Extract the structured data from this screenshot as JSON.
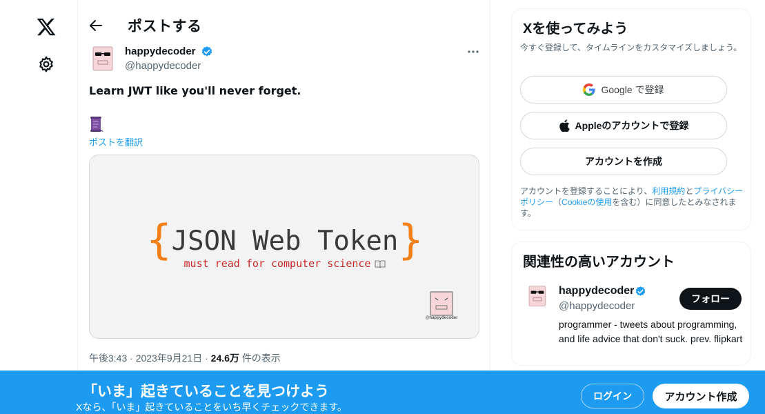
{
  "nav": {
    "logo_icon": "x-logo-icon",
    "settings_icon": "gear-icon"
  },
  "header": {
    "title": "ポストする",
    "back_icon": "arrow-left-icon"
  },
  "tweet": {
    "author_name": "happydecoder",
    "author_handle": "@happydecoder",
    "text": "Learn JWT like you'll never forget.",
    "translate_link": "ポストを翻訳",
    "media": {
      "title": "JSON Web Token",
      "brace_open": "{",
      "brace_close": "}",
      "subtitle": "must read for computer science",
      "logo_label": "@happydecoder"
    },
    "time": "午後3:43",
    "date": "2023年9月21日",
    "separator": "·",
    "views": "24.6万",
    "views_label": "件の表示"
  },
  "signup_card": {
    "title": "Xを使ってみよう",
    "subtitle": "今すぐ登録して、タイムラインをカスタマイズしましょう。",
    "google_label": "Google で登録",
    "apple_label": "Appleのアカウントで登録",
    "create_label": "アカウントを作成",
    "legal": {
      "part1": "アカウントを登録することにより、",
      "terms": "利用規約",
      "and": "と",
      "privacy": "プライバシーポリシー",
      "paren_open": "（",
      "cookie": "Cookieの使用",
      "part2": "を含む）に同意したとみなされます。"
    }
  },
  "related": {
    "title": "関連性の高いアカウント",
    "name": "happydecoder",
    "handle": "@happydecoder",
    "follow_label": "フォロー",
    "bio": "programmer - tweets about programming, and life advice that don't suck. prev. flipkart"
  },
  "banner": {
    "title": "「いま」起きていることを見つけよう",
    "subtitle": "Xなら、「いま」起きていることをいち早くチェックできます。",
    "login_label": "ログイン",
    "signup_label": "アカウント作成"
  },
  "colors": {
    "accent": "#1d9bf0",
    "text": "#0f1419",
    "muted": "#536471",
    "brace": "#f57f17",
    "subtitle_red": "#c62828"
  }
}
